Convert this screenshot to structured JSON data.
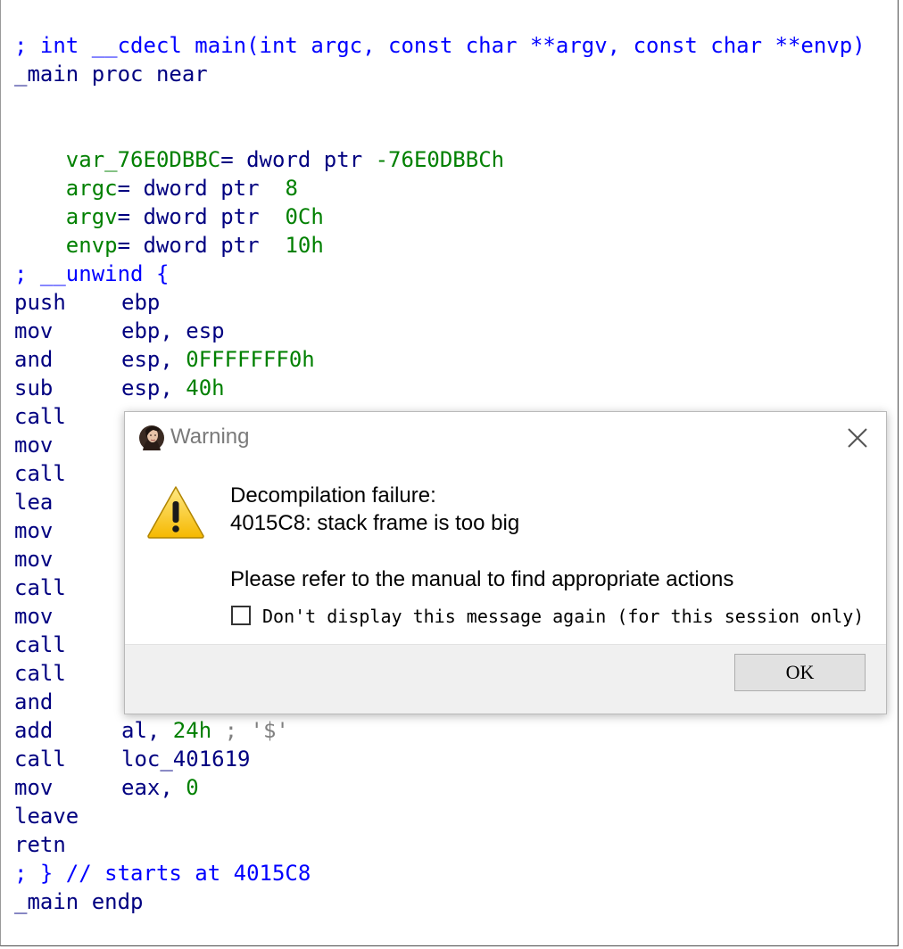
{
  "code": {
    "proto_comment": "; int __cdecl main(int argc, const char **argv, const char **envp)",
    "proc_start": "_main proc near",
    "vars": [
      {
        "name": "var_76E0DBBC",
        "sep": "= ",
        "type": "dword ptr ",
        "value": "-76E0DBBCh"
      },
      {
        "name": "argc",
        "sep": "= ",
        "type": "dword ptr  ",
        "value": "8"
      },
      {
        "name": "argv",
        "sep": "= ",
        "type": "dword ptr  ",
        "value": "0Ch"
      },
      {
        "name": "envp",
        "sep": "= ",
        "type": "dword ptr  ",
        "value": "10h"
      }
    ],
    "unwind_comment": "; __unwind {",
    "instructions": [
      {
        "mnemonic": "push",
        "operand": "ebp"
      },
      {
        "mnemonic": "mov",
        "operand": "ebp, esp"
      },
      {
        "mnemonic": "and",
        "operand": "esp, ",
        "operand_num": "0FFFFFFF0h"
      },
      {
        "mnemonic": "sub",
        "operand": "esp, ",
        "operand_num": "40h"
      },
      {
        "mnemonic": "call",
        "operand": ""
      },
      {
        "mnemonic": "mov",
        "operand": ""
      },
      {
        "mnemonic": "call",
        "operand": ""
      },
      {
        "mnemonic": "lea",
        "operand": ""
      },
      {
        "mnemonic": "mov",
        "operand": ""
      },
      {
        "mnemonic": "mov",
        "operand": ""
      },
      {
        "mnemonic": "call",
        "operand": ""
      },
      {
        "mnemonic": "mov",
        "operand": ""
      },
      {
        "mnemonic": "call",
        "operand": ""
      },
      {
        "mnemonic": "call",
        "operand": ""
      },
      {
        "mnemonic": "and",
        "operand": ""
      },
      {
        "mnemonic": "add",
        "operand": "al, ",
        "operand_num": "24h",
        "comment": " ; '$'"
      },
      {
        "mnemonic": "call",
        "operand": "loc_401619"
      },
      {
        "mnemonic": "mov",
        "operand": "eax, ",
        "operand_num": "0"
      },
      {
        "mnemonic": "leave",
        "operand": ""
      },
      {
        "mnemonic": "retn",
        "operand": ""
      }
    ],
    "unwind_end_comment": "; } // starts at 4015C8",
    "proc_end": "_main endp"
  },
  "dialog": {
    "title": "Warning",
    "title_icon": "app-avatar-icon",
    "close_icon": "close-icon",
    "warning_icon": "warning-icon",
    "message_line1": "Decompilation failure:",
    "message_line2": "4015C8: stack frame is too big",
    "message_line3": "Please refer to the manual to find appropriate actions",
    "checkbox_label": "Don't display this message again (for this session only)",
    "checkbox_checked": false,
    "ok_label": "OK"
  },
  "colors": {
    "comment_blue": "#0000ff",
    "code_navy": "#000080",
    "stack_var_green": "#008000",
    "number_green": "#008000"
  }
}
